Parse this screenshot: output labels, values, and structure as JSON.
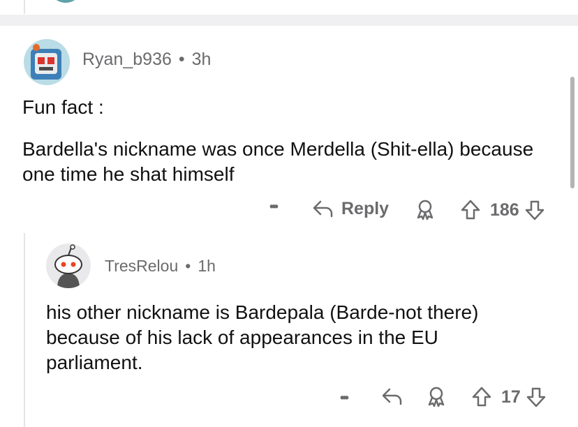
{
  "comments": [
    {
      "username": "Ryan_b936",
      "separator": "•",
      "age": "3h",
      "paragraphs": [
        "Fun fact :",
        "Bardella's nickname was once Merdella (Shit-ella) because one time he shat himself"
      ],
      "actions": {
        "more": "•••",
        "reply": "Reply",
        "votes": "186"
      }
    },
    {
      "username": "TresRelou",
      "separator": "•",
      "age": "1h",
      "paragraphs": [
        "his other nickname is Bardepala (Barde-not there) because of his lack of appearances in the EU parliament."
      ],
      "actions": {
        "more": "•••",
        "votes": "17"
      }
    }
  ],
  "icons": [
    "reply-arrow-icon",
    "award-icon",
    "upvote-icon",
    "downvote-icon",
    "more-options-icon",
    "avatar"
  ],
  "colors": {
    "meta_text": "#6b6b6e",
    "separator_band": "#f0f0f2",
    "thread_line": "#e5e5e5"
  }
}
